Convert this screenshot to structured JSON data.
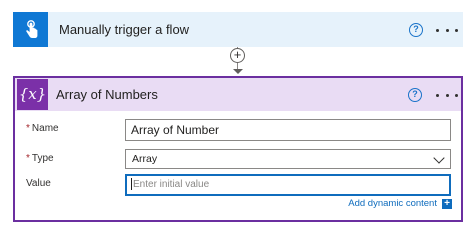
{
  "trigger": {
    "title": "Manually trigger a flow",
    "icon": "touch-hand-icon",
    "icon_color": "#0f78d4",
    "background": "#e6f2fb",
    "help_symbol": "?"
  },
  "connector": {
    "add_symbol": "+"
  },
  "action": {
    "title": "Array of Numbers",
    "icon": "variable-icon",
    "icon_glyph": "{x}",
    "accent": "#6b2fa0",
    "header_background": "#e9dcf4",
    "help_symbol": "?",
    "fields": {
      "name": {
        "label": "Name",
        "required_mark": "*",
        "value": "Array of Number"
      },
      "type": {
        "label": "Type",
        "required_mark": "*",
        "value": "Array"
      },
      "value": {
        "label": "Value",
        "placeholder": "Enter initial value"
      }
    },
    "dynamic_content_label": "Add dynamic content",
    "dynamic_badge": "+"
  }
}
